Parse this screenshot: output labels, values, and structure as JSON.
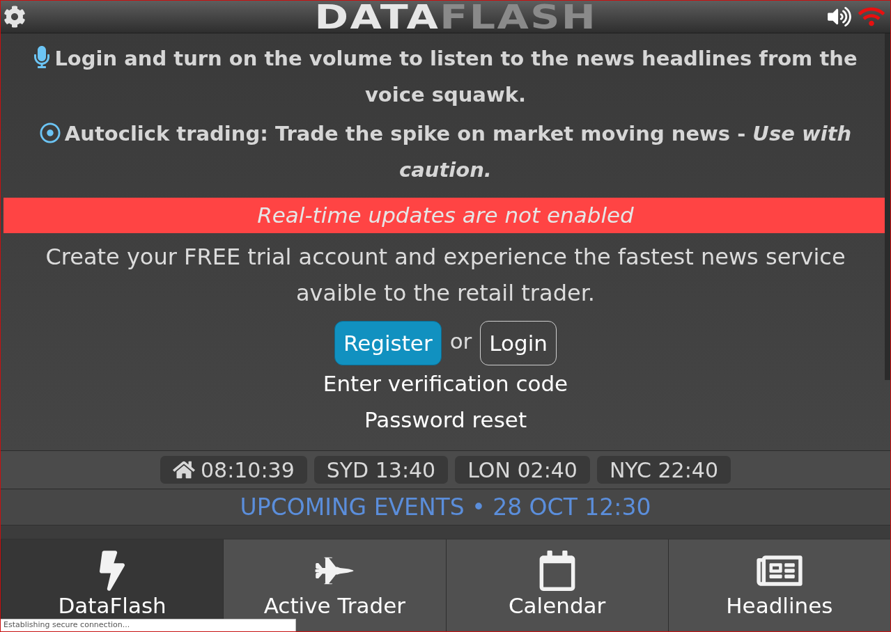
{
  "header": {
    "logo": {
      "bright": "DATA",
      "dim": "FLASH"
    }
  },
  "notices": [
    {
      "kind": "voice",
      "text": "Login and turn on the volume to listen to the news headlines from the voice squawk."
    },
    {
      "kind": "autoclick",
      "text": "Autoclick trading: Trade the spike on market moving news - *Use with caution.*"
    }
  ],
  "alert": "Real-time updates are not enabled",
  "promo": "Create your FREE trial account and experience the fastest news service avaible to the retail trader.",
  "actions": {
    "register": "Register",
    "separator": "or",
    "login": "Login"
  },
  "links": [
    "Enter verification code",
    "Password reset"
  ],
  "clocks": [
    {
      "kind": "home",
      "label": "08:10:39"
    },
    {
      "kind": "city",
      "label": "SYD 13:40"
    },
    {
      "kind": "city",
      "label": "LON 02:40"
    },
    {
      "kind": "city",
      "label": "NYC 22:40"
    }
  ],
  "upcoming": "UPCOMING EVENTS • 28 OCT 12:30",
  "tabs": [
    {
      "kind": "bolt",
      "label": "DataFlash",
      "selected": true
    },
    {
      "kind": "jet",
      "label": "Active Trader",
      "selected": false
    },
    {
      "kind": "calendar",
      "label": "Calendar",
      "selected": false
    },
    {
      "kind": "newspaper",
      "label": "Headlines",
      "selected": false
    }
  ],
  "status_bar": "Establishing secure connection..."
}
